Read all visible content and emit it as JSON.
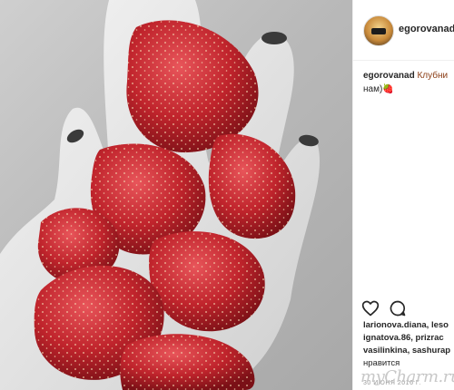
{
  "post": {
    "username": "egorovanad",
    "caption": {
      "username": "egorovanad",
      "line1": "Клубни",
      "line2": "нам)🍓"
    },
    "likes_lines": [
      "larionova.diana, leso",
      "ignatova.86, prizrac",
      "vasilinkina, sashurap"
    ],
    "likes_suffix": "нравится",
    "date": "30 ИЮНЯ 2016 Г."
  },
  "icons": {
    "like": "heart-icon",
    "comment": "comment-icon"
  },
  "watermark": "myCharm.ru",
  "colors": {
    "strawberry": "#c1272d",
    "background_gray": "#bdbdbd"
  }
}
